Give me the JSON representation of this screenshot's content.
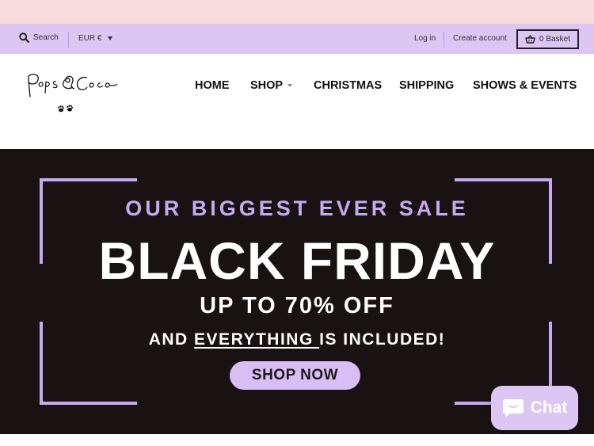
{
  "topbar": {
    "search_label": "Search",
    "currency": "EUR €",
    "login": "Log in",
    "create_account": "Create account",
    "basket": "0 Basket"
  },
  "header": {
    "logo_text": "Pops & Coco",
    "nav": [
      "HOME",
      "SHOP",
      "CHRISTMAS",
      "SHIPPING",
      "SHOWS & EVENTS"
    ]
  },
  "hero": {
    "subtitle": "OUR BIGGEST EVER SALE",
    "title": "BLACK FRIDAY",
    "discount": "UP TO 70% OFF",
    "included_pre": "AND ",
    "included_underlined": "EVERYTHING ",
    "included_post": "IS INCLUDED!",
    "cta": "SHOP NOW"
  },
  "chat": {
    "label": "Chat"
  },
  "colors": {
    "announcement_bg": "#f8dcdc",
    "utility_bg": "#dcc6f4",
    "hero_bg": "#181212",
    "accent_lavender": "#c8a8ee"
  },
  "icons": [
    "search-icon",
    "chevron-down-icon",
    "basket-icon",
    "paw-icon",
    "chat-icon"
  ]
}
